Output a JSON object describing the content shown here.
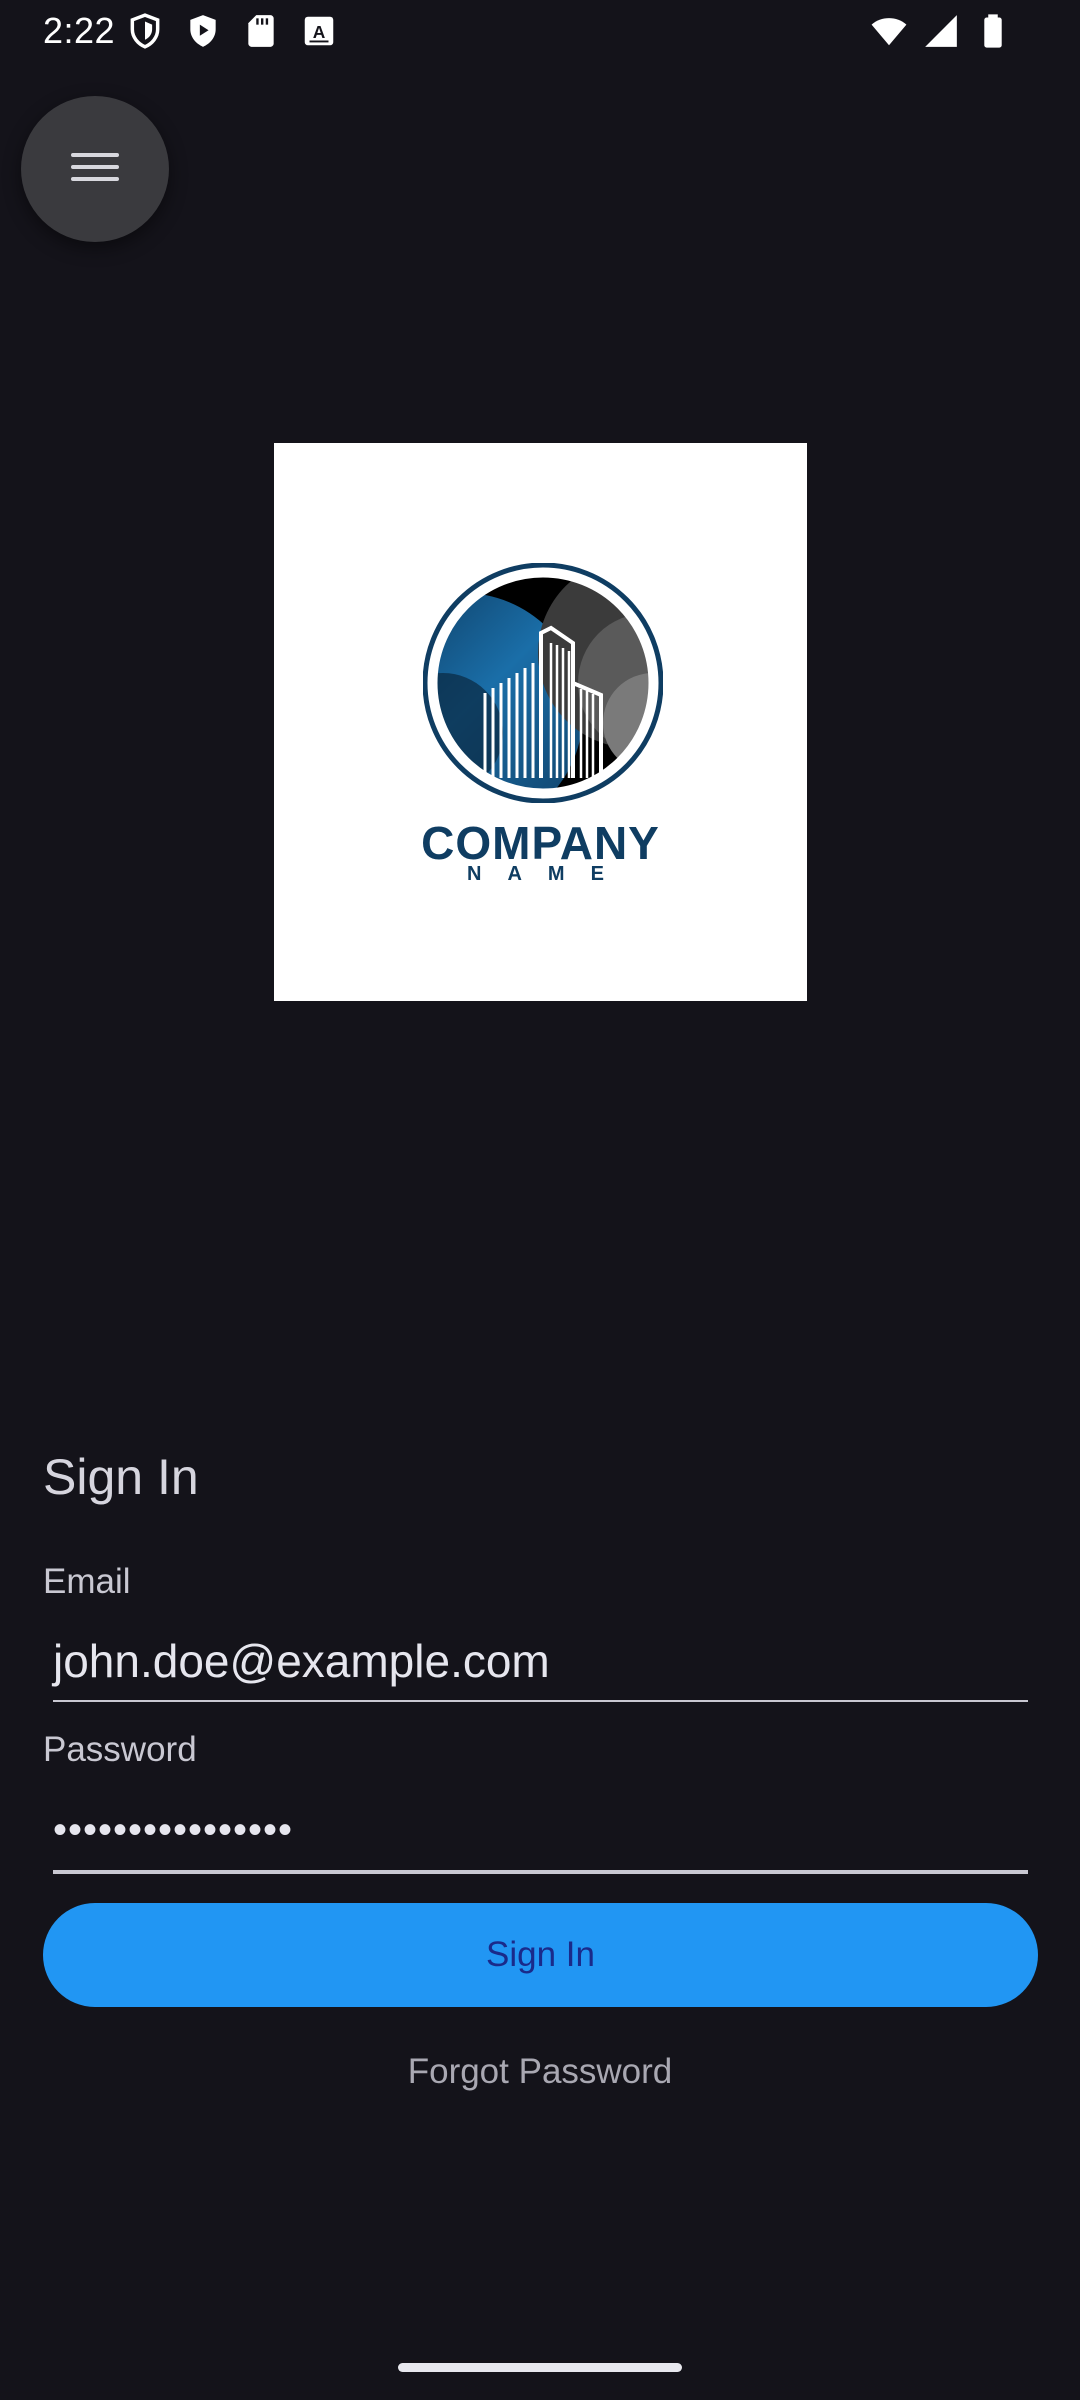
{
  "status_bar": {
    "time": "2:22",
    "left_icons": [
      "shield-icon",
      "play-protect-icon",
      "sd-card-icon",
      "keyboard-a-icon"
    ],
    "right_icons": [
      "wifi-icon",
      "signal-icon",
      "battery-icon"
    ]
  },
  "menu": {
    "icon": "hamburger-menu-icon"
  },
  "logo": {
    "company": "COMPANY",
    "name": "NAME",
    "colors": {
      "primary": "#0f3d62",
      "accent": "#1e6fa8"
    }
  },
  "form": {
    "heading": "Sign In",
    "email_label": "Email",
    "email_value": "john.doe@example.com",
    "password_label": "Password",
    "password_value": "••••••••••••••••",
    "submit_label": "Sign In",
    "forgot_label": "Forgot Password"
  },
  "colors": {
    "background": "#14131a",
    "button": "#2196f3",
    "button_text": "#1a2a8a"
  }
}
